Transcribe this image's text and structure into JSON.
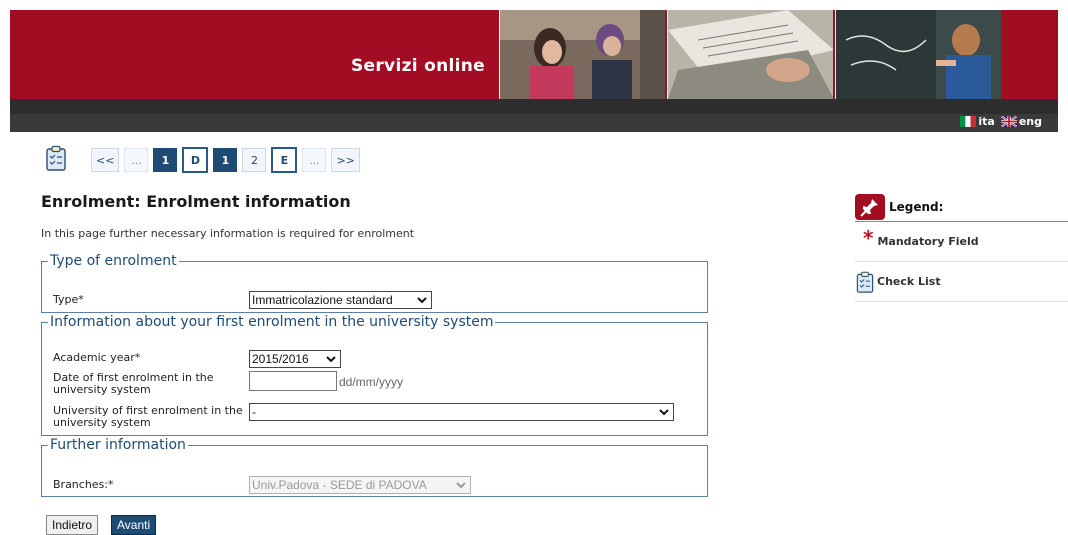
{
  "header": {
    "title": "Servizi online",
    "brand_color": "#a30d24",
    "languages": [
      {
        "code": "ita",
        "label": "ita"
      },
      {
        "code": "eng",
        "label": "eng"
      }
    ]
  },
  "steps": {
    "items": [
      {
        "label": "<<",
        "state": "nav"
      },
      {
        "label": "...",
        "state": "plain"
      },
      {
        "label": "1",
        "state": "active"
      },
      {
        "label": "D",
        "state": "boxed"
      },
      {
        "label": "1",
        "state": "active"
      },
      {
        "label": "2",
        "state": "num"
      },
      {
        "label": "E",
        "state": "boxed"
      },
      {
        "label": "...",
        "state": "plain"
      },
      {
        "label": ">>",
        "state": "nav"
      }
    ]
  },
  "page": {
    "title": "Enrolment: Enrolment information",
    "intro": "In this page further necessary information is required for enrolment"
  },
  "sections": {
    "type_of_enrolment": {
      "legend": "Type of enrolment",
      "type_label": "Type*",
      "type_value": "Immatricolazione standard"
    },
    "first_enrolment": {
      "legend": "Information about your first enrolment in the university system",
      "academic_year_label": "Academic year*",
      "academic_year_value": "2015/2016",
      "date_label": "Date of first enrolment in the university system",
      "date_value": "",
      "date_hint": "dd/mm/yyyy",
      "university_label": "University of first enrolment in the university system",
      "university_value": "-"
    },
    "further_information": {
      "legend": "Further information",
      "branches_label": "Branches:*",
      "branches_value": "Univ.Padova - SEDE di PADOVA"
    }
  },
  "buttons": {
    "back_label": "Indietro",
    "next_label": "Avanti"
  },
  "legend_panel": {
    "title": "Legend:",
    "mandatory_label": "Mandatory Field",
    "checklist_label": "Check List"
  }
}
